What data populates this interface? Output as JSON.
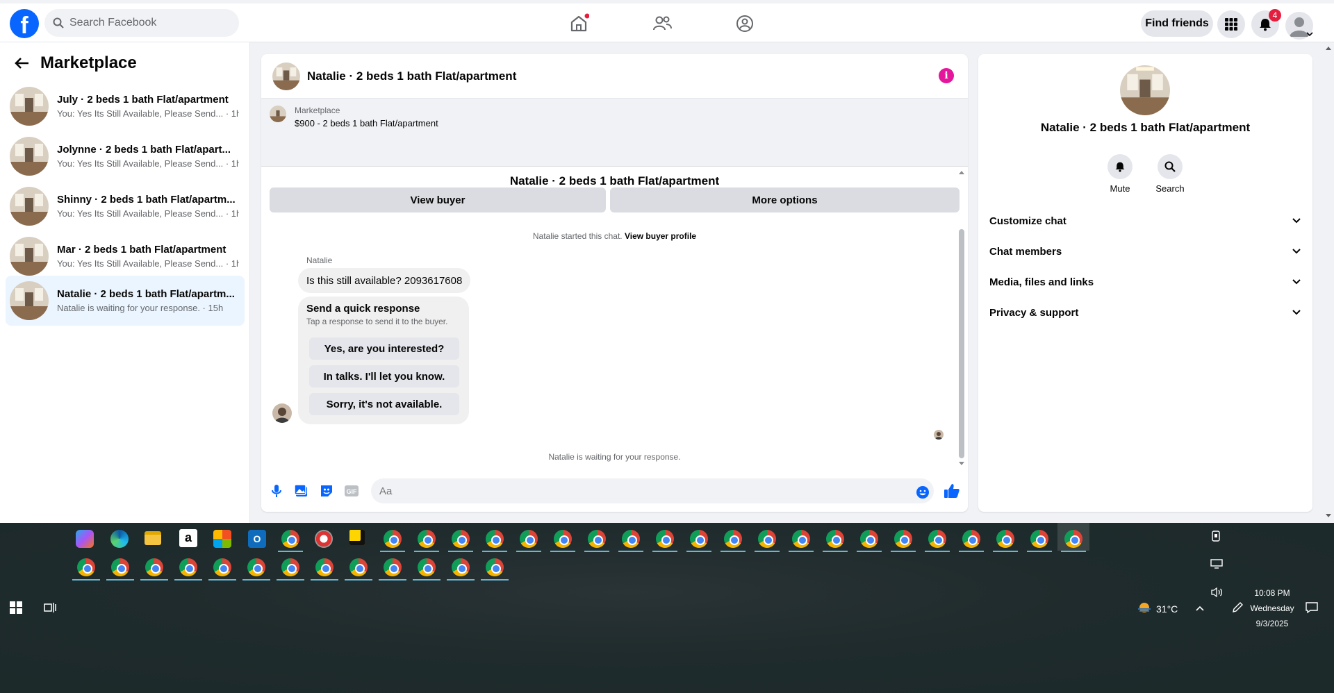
{
  "topbar": {
    "search_placeholder": "Search Facebook",
    "find_friends": "Find friends",
    "notification_count": "4",
    "accent_color": "#0866ff"
  },
  "sidebar": {
    "title": "Marketplace",
    "conversations": [
      {
        "title": "July · 2 beds 1 bath Flat/apartment",
        "preview": "You: Yes Its Still Available, Please Send... · 1h"
      },
      {
        "title": "Jolynne · 2 beds 1 bath Flat/apart...",
        "preview": "You: Yes Its Still Available, Please Send... · 1h"
      },
      {
        "title": "Shinny · 2 beds 1 bath Flat/apartm...",
        "preview": "You: Yes Its Still Available, Please Send... · 1h"
      },
      {
        "title": "Mar · 2 beds 1 bath Flat/apartment",
        "preview": "You: Yes Its Still Available, Please Send... · 1h"
      },
      {
        "title": "Natalie · 2 beds 1 bath Flat/apartm...",
        "preview": "Natalie is waiting for your response. · 15h"
      }
    ]
  },
  "chat": {
    "header_title": "Natalie · 2 beds 1 bath Flat/apartment",
    "listing_source": "Marketplace",
    "listing_price": "$900 - 2 beds 1 bath Flat/apartment",
    "view_buyer": "View buyer",
    "more_options": "More options",
    "conversation_title": "Natalie · 2 beds 1 bath Flat/apartment",
    "started_text": "Natalie started this chat.",
    "view_buyer_profile": "View buyer profile",
    "sender_name": "Natalie",
    "message": "Is this still available? 2093617608",
    "quick_title": "Send a quick response",
    "quick_subtitle": "Tap a response to send it to the buyer.",
    "quick_responses": [
      "Yes, are you interested?",
      "In talks. I'll let you know.",
      "Sorry, it's not available."
    ],
    "waiting_text": "Natalie is waiting for your response.",
    "composer_placeholder": "Aa",
    "gif_label": "GIF"
  },
  "details": {
    "name": "Natalie · 2 beds 1 bath Flat/apartment",
    "mute": "Mute",
    "search": "Search",
    "sections": [
      "Customize chat",
      "Chat members",
      "Media, files and links",
      "Privacy & support"
    ]
  },
  "taskbar": {
    "weather": "31°C",
    "time": "10:08 PM",
    "day": "Wednesday",
    "date": "9/3/2025"
  }
}
